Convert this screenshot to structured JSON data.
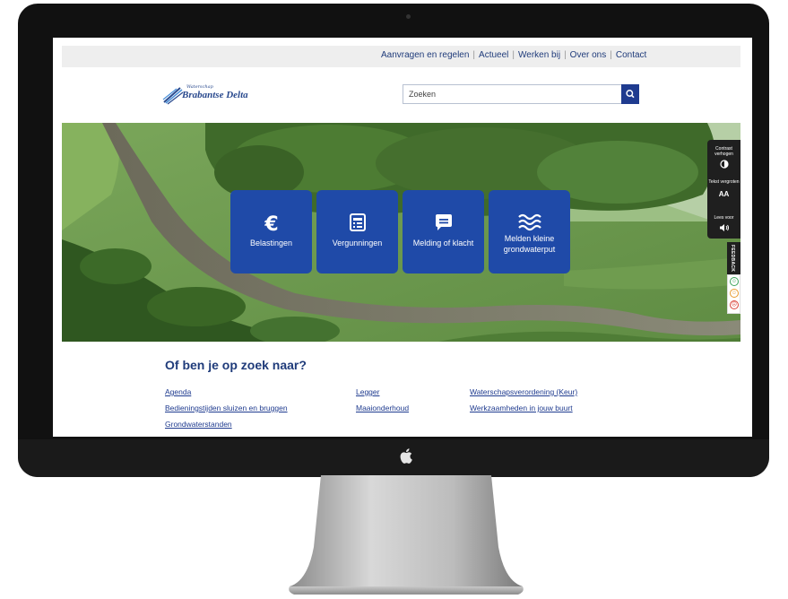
{
  "topnav": {
    "items": [
      "Aanvragen en regelen",
      "Actueel",
      "Werken bij",
      "Over ons",
      "Contact"
    ]
  },
  "logo": {
    "small_text": "Waterschap",
    "name": "Brabantse Delta"
  },
  "search": {
    "placeholder": "Zoeken"
  },
  "tiles": [
    {
      "label": "Belastingen",
      "icon": "euro-icon"
    },
    {
      "label": "Vergunningen",
      "icon": "document-icon"
    },
    {
      "label": "Melding of klacht",
      "icon": "chat-icon"
    },
    {
      "label": "Melden kleine grondwaterput",
      "icon": "water-waves-icon"
    }
  ],
  "accessibility": {
    "contrast": "Contrast verhogen",
    "text_size": "Tekst vergroten",
    "text_size_glyph": "AA",
    "read_aloud": "Lees voor"
  },
  "feedback": {
    "label": "FEEDBACK"
  },
  "section": {
    "title": "Of ben je op zoek naar?",
    "links_col1": [
      "Agenda",
      "Bedieningstijden sluizen en bruggen",
      "Grondwaterstanden"
    ],
    "links_col2": [
      "Legger",
      "Maaionderhoud"
    ],
    "links_col3": [
      "Waterschapsverordening (Keur)",
      "Werkzaamheden in jouw buurt"
    ]
  },
  "colors": {
    "brand_blue": "#1f4aa8",
    "link_blue": "#1f3b8f",
    "topbar_bg": "#eeeeee"
  }
}
